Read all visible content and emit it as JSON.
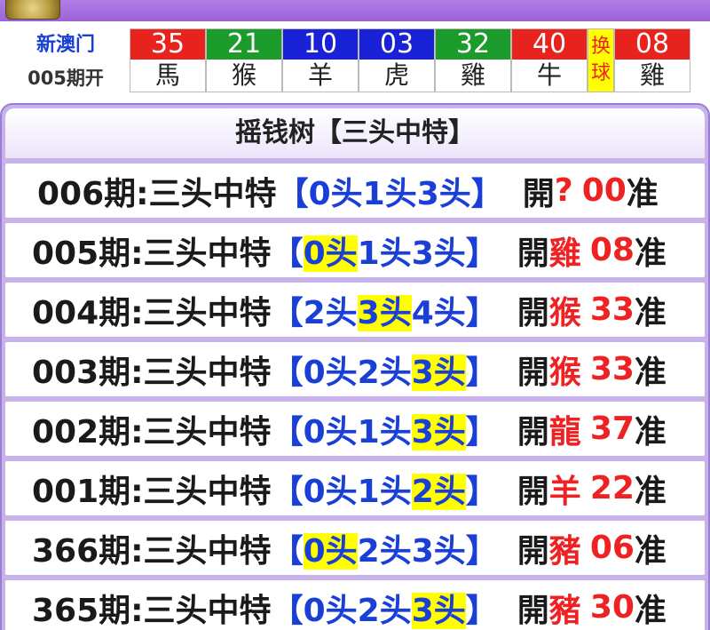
{
  "header": {
    "banner_text": "",
    "banner_right_text": ""
  },
  "result": {
    "site_name": "新澳门",
    "issue_open": "005期开",
    "swap_chars": [
      "换",
      "球"
    ],
    "balls": [
      {
        "num": "35",
        "zodiac": "馬",
        "color": "#e8231e"
      },
      {
        "num": "21",
        "zodiac": "猴",
        "color": "#1b9b2a"
      },
      {
        "num": "10",
        "zodiac": "羊",
        "color": "#1a22d8"
      },
      {
        "num": "03",
        "zodiac": "虎",
        "color": "#1a22d8"
      },
      {
        "num": "32",
        "zodiac": "雞",
        "color": "#1b9b2a"
      },
      {
        "num": "40",
        "zodiac": "牛",
        "color": "#e8231e"
      }
    ],
    "special": {
      "num": "08",
      "zodiac": "雞",
      "color": "#e8231e"
    }
  },
  "panel": {
    "title": "摇钱树【三头中特】"
  },
  "rows": [
    {
      "issue": "006期:",
      "label": "三头中特",
      "open_bracket": "【",
      "heads": [
        "0头",
        "1头",
        "3头"
      ],
      "highlight": -1,
      "close_bracket": "】",
      "open": "開",
      "zodiac": "?",
      "num": "00",
      "zhun": "准"
    },
    {
      "issue": "005期:",
      "label": "三头中特",
      "open_bracket": "【",
      "heads": [
        "0头",
        "1头",
        "3头"
      ],
      "highlight": 0,
      "close_bracket": "】",
      "open": "開",
      "zodiac": "雞",
      "num": "08",
      "zhun": "准"
    },
    {
      "issue": "004期:",
      "label": "三头中特",
      "open_bracket": "【",
      "heads": [
        "2头",
        "3头",
        "4头"
      ],
      "highlight": 1,
      "close_bracket": "】",
      "open": "開",
      "zodiac": "猴",
      "num": "33",
      "zhun": "准"
    },
    {
      "issue": "003期:",
      "label": "三头中特",
      "open_bracket": "【",
      "heads": [
        "0头",
        "2头",
        "3头"
      ],
      "highlight": 2,
      "close_bracket": "】",
      "open": "開",
      "zodiac": "猴",
      "num": "33",
      "zhun": "准"
    },
    {
      "issue": "002期:",
      "label": "三头中特",
      "open_bracket": "【",
      "heads": [
        "0头",
        "1头",
        "3头"
      ],
      "highlight": 2,
      "close_bracket": "】",
      "open": "開",
      "zodiac": "龍",
      "num": "37",
      "zhun": "准"
    },
    {
      "issue": "001期:",
      "label": "三头中特",
      "open_bracket": "【",
      "heads": [
        "0头",
        "1头",
        "2头"
      ],
      "highlight": 2,
      "close_bracket": "】",
      "open": "開",
      "zodiac": "羊",
      "num": "22",
      "zhun": "准"
    },
    {
      "issue": "366期:",
      "label": "三头中特",
      "open_bracket": "【",
      "heads": [
        "0头",
        "2头",
        "3头"
      ],
      "highlight": 0,
      "close_bracket": "】",
      "open": "開",
      "zodiac": "豬",
      "num": "06",
      "zhun": "准"
    },
    {
      "issue": "365期:",
      "label": "三头中特",
      "open_bracket": "【",
      "heads": [
        "0头",
        "2头",
        "3头"
      ],
      "highlight": 2,
      "close_bracket": "】",
      "open": "開",
      "zodiac": "豬",
      "num": "30",
      "zhun": "准"
    }
  ]
}
